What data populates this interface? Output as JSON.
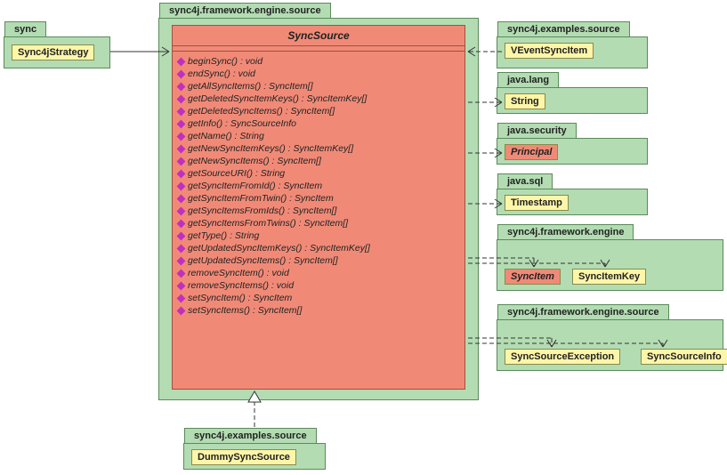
{
  "main_package": "sync4j.framework.engine.source",
  "main_class": "SyncSource",
  "methods": [
    "beginSync() : void",
    "endSync() : void",
    "getAllSyncItems() : SyncItem[]",
    "getDeletedSyncItemKeys() : SyncItemKey[]",
    "getDeletedSyncItems() : SyncItem[]",
    "getInfo() : SyncSourceInfo",
    "getName() : String",
    "getNewSyncItemKeys() : SyncItemKey[]",
    "getNewSyncItems() : SyncItem[]",
    "getSourceURI() : String",
    "getSyncItemFromId() : SyncItem",
    "getSyncItemFromTwin() : SyncItem",
    "getSyncItemsFromIds() : SyncItem[]",
    "getSyncItemsFromTwins() : SyncItem[]",
    "getType() : String",
    "getUpdatedSyncItemKeys() : SyncItemKey[]",
    "getUpdatedSyncItems() : SyncItem[]",
    "removeSyncItem() : void",
    "removeSyncItems() : void",
    "setSyncItem() : SyncItem",
    "setSyncItems() : SyncItem[]"
  ],
  "left_pkg": {
    "name": "sync",
    "class": "Sync4jStrategy"
  },
  "bottom_pkg": {
    "name": "sync4j.examples.source",
    "class": "DummySyncSource"
  },
  "right_pkgs": [
    {
      "name": "sync4j.examples.source",
      "classes": [
        {
          "t": "VEventSyncItem",
          "em": false
        }
      ]
    },
    {
      "name": "java.lang",
      "classes": [
        {
          "t": "String",
          "em": false
        }
      ]
    },
    {
      "name": "java.security",
      "classes": [
        {
          "t": "Principal",
          "em": true
        }
      ]
    },
    {
      "name": "java.sql",
      "classes": [
        {
          "t": "Timestamp",
          "em": false
        }
      ]
    },
    {
      "name": "sync4j.framework.engine",
      "classes": [
        {
          "t": "SyncItem",
          "em": true
        },
        {
          "t": "SyncItemKey",
          "em": false
        }
      ]
    },
    {
      "name": "sync4j.framework.engine.source",
      "classes": [
        {
          "t": "SyncSourceException",
          "em": false
        },
        {
          "t": "SyncSourceInfo",
          "em": false
        }
      ]
    }
  ],
  "chart_data": {
    "type": "diagram",
    "kind": "uml_class_diagram",
    "packages": [
      {
        "name": "sync",
        "classes": [
          "Sync4jStrategy"
        ]
      },
      {
        "name": "sync4j.framework.engine.source",
        "classes": [
          "SyncSource",
          "SyncSourceException",
          "SyncSourceInfo"
        ]
      },
      {
        "name": "sync4j.examples.source",
        "classes": [
          "VEventSyncItem",
          "DummySyncSource"
        ]
      },
      {
        "name": "java.lang",
        "classes": [
          "String"
        ]
      },
      {
        "name": "java.security",
        "classes": [
          "Principal"
        ]
      },
      {
        "name": "java.sql",
        "classes": [
          "Timestamp"
        ]
      },
      {
        "name": "sync4j.framework.engine",
        "classes": [
          "SyncItem",
          "SyncItemKey"
        ]
      }
    ],
    "relationships": [
      {
        "from": "Sync4jStrategy",
        "to": "SyncSource",
        "type": "association"
      },
      {
        "from": "VEventSyncItem",
        "to": "SyncSource",
        "type": "dependency"
      },
      {
        "from": "SyncSource",
        "to": "String",
        "type": "dependency"
      },
      {
        "from": "SyncSource",
        "to": "Principal",
        "type": "dependency"
      },
      {
        "from": "SyncSource",
        "to": "Timestamp",
        "type": "dependency"
      },
      {
        "from": "SyncSource",
        "to": "SyncItem",
        "type": "dependency"
      },
      {
        "from": "SyncSource",
        "to": "SyncItemKey",
        "type": "dependency"
      },
      {
        "from": "SyncSource",
        "to": "SyncSourceException",
        "type": "dependency"
      },
      {
        "from": "SyncSource",
        "to": "SyncSourceInfo",
        "type": "dependency"
      },
      {
        "from": "DummySyncSource",
        "to": "SyncSource",
        "type": "realization"
      }
    ]
  }
}
